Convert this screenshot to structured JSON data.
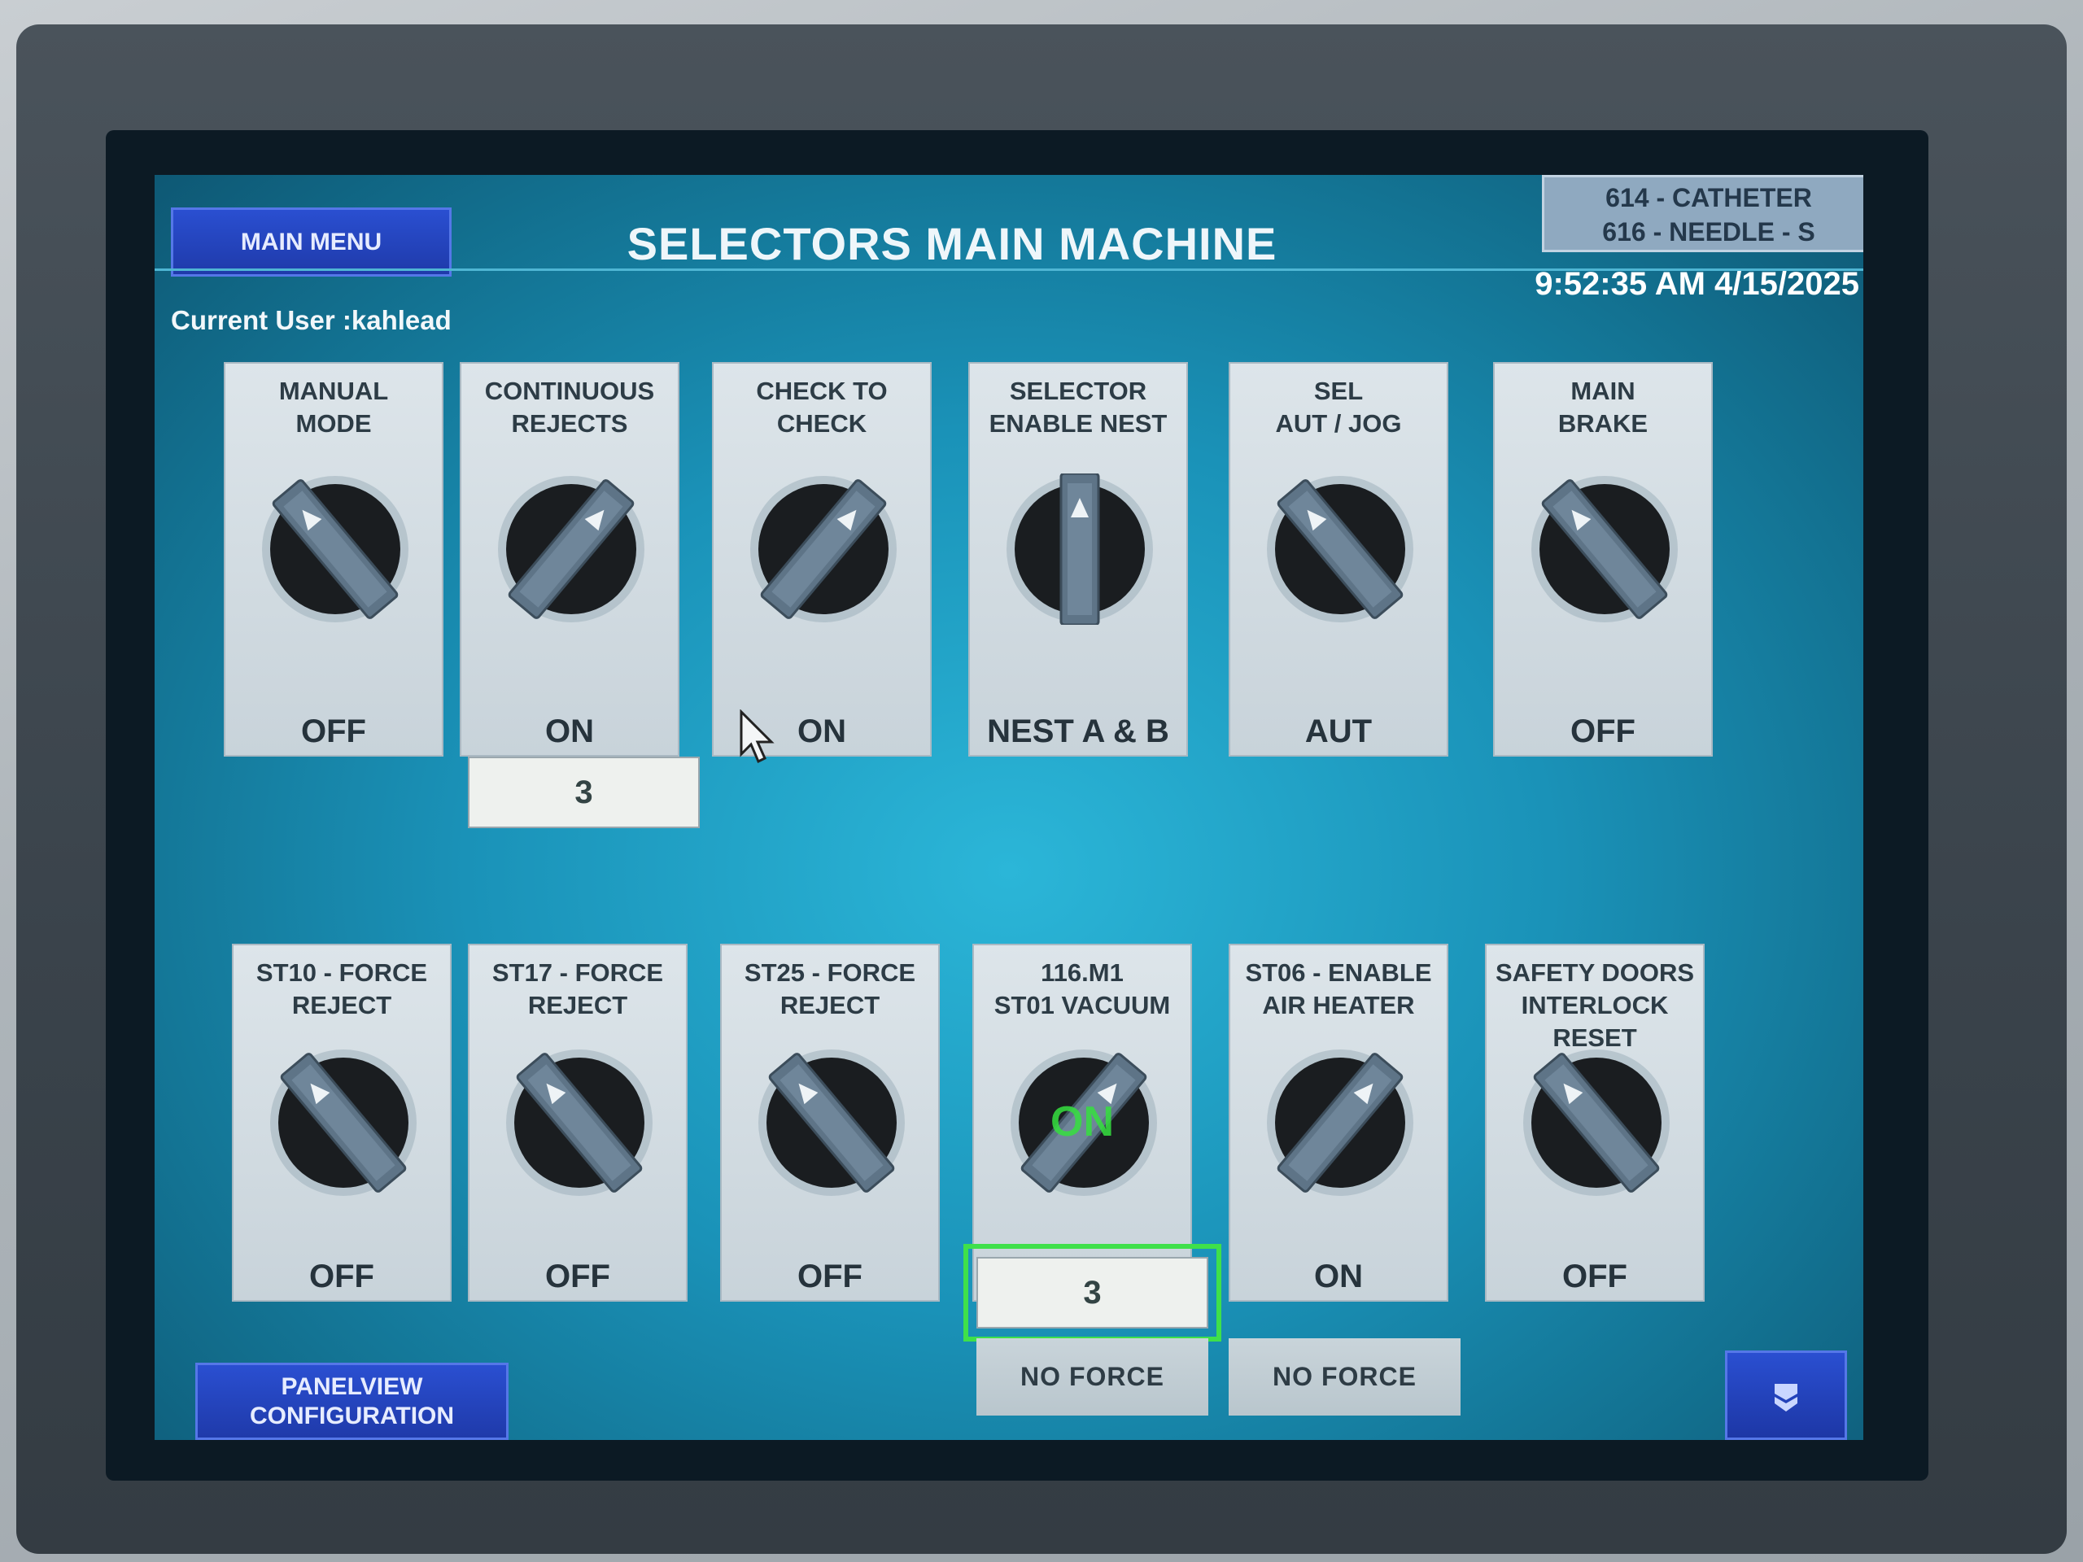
{
  "header": {
    "main_menu_label": "MAIN MENU",
    "title": "SELECTORS MAIN MACHINE",
    "product_line1": "614 - CATHETER",
    "product_line2": "616 - NEEDLE - S",
    "datetime": "9:52:35 AM 4/15/2025",
    "current_user": "Current User :kahlead"
  },
  "top_selectors": [
    {
      "title1": "MANUAL",
      "title2": "MODE",
      "state": "OFF",
      "position": "left"
    },
    {
      "title1": "CONTINUOUS",
      "title2": "REJECTS",
      "state": "ON",
      "position": "right"
    },
    {
      "title1": "CHECK TO",
      "title2": "CHECK",
      "state": "ON",
      "position": "right"
    },
    {
      "title1": "SELECTOR",
      "title2": "ENABLE NEST",
      "state": "NEST A & B",
      "position": "center"
    },
    {
      "title1": "SEL",
      "title2": "AUT / JOG",
      "state": "AUT",
      "position": "left"
    },
    {
      "title1": "MAIN",
      "title2": "BRAKE",
      "state": "OFF",
      "position": "left"
    }
  ],
  "continuous_rejects_count": "3",
  "bottom_selectors": [
    {
      "title1": "ST10 - FORCE",
      "title2": "REJECT",
      "title3": "",
      "state": "OFF",
      "position": "left"
    },
    {
      "title1": "ST17 - FORCE",
      "title2": "REJECT",
      "title3": "",
      "state": "OFF",
      "position": "left"
    },
    {
      "title1": "ST25 - FORCE",
      "title2": "REJECT",
      "title3": "",
      "state": "OFF",
      "position": "left"
    },
    {
      "title1": "116.M1",
      "title2": "ST01 VACUUM",
      "title3": "",
      "state": "",
      "position": "right",
      "indicator": "ON"
    },
    {
      "title1": "ST06 - ENABLE",
      "title2": "AIR HEATER",
      "title3": "",
      "state": "ON",
      "position": "right"
    },
    {
      "title1": "SAFETY DOORS",
      "title2": "INTERLOCK",
      "title3": "RESET",
      "state": "OFF",
      "position": "left"
    }
  ],
  "vacuum_count": "3",
  "no_force_1": "NO FORCE",
  "no_force_2": "NO FORCE",
  "footer": {
    "panelview_line1": "PANELVIEW",
    "panelview_line2": "CONFIGURATION",
    "down_icon": "chevron-down-icon"
  },
  "colors": {
    "screen_bg": "#1a92b8",
    "button_blue": "#1f3aaa",
    "selection_green": "#3fe04a"
  }
}
